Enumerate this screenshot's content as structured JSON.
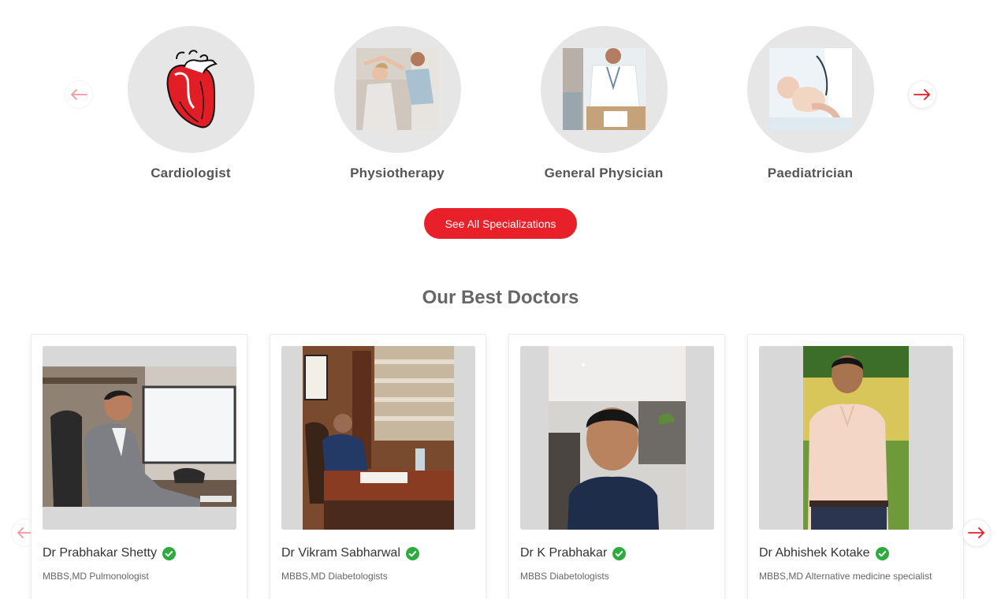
{
  "specializations": {
    "items": [
      {
        "label": "Cardiologist",
        "icon": "heart-icon"
      },
      {
        "label": "Physiotherapy",
        "icon": "physiotherapy-photo"
      },
      {
        "label": "General Physician",
        "icon": "general-physician-photo"
      },
      {
        "label": "Paediatrician",
        "icon": "paediatrician-photo"
      }
    ],
    "see_all_label": "See All Specializations"
  },
  "doctors": {
    "title": "Our Best Doctors",
    "items": [
      {
        "name": "Dr Prabhakar Shetty",
        "qualification": "MBBS,MD Pulmonologist"
      },
      {
        "name": "Dr Vikram Sabharwal",
        "qualification": "MBBS,MD Diabetologists"
      },
      {
        "name": "Dr K Prabhakar",
        "qualification": "MBBS Diabetologists"
      },
      {
        "name": "Dr Abhishek Kotake",
        "qualification": "MBBS,MD Alternative medicine specialist"
      }
    ]
  },
  "colors": {
    "accent": "#e8202a",
    "verified": "#2eaa3f",
    "circle_bg": "#e6e6e6"
  }
}
